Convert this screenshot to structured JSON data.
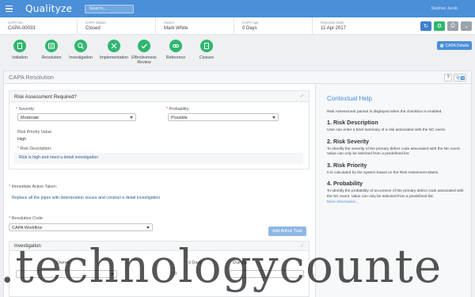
{
  "app": {
    "logo": "Qualityze",
    "search_placeholder": "Search...",
    "user_label": "Stephen Jacob"
  },
  "info": {
    "fields": [
      {
        "label": "CAPA No.",
        "value": "CAPA-00033"
      },
      {
        "label": "CAPA Status",
        "value": "Closed"
      },
      {
        "label": "Owner",
        "value": "Mark White"
      },
      {
        "label": "CAPA Age",
        "value": "0 Days"
      },
      {
        "label": "Reported Date",
        "value": "11 Apr 2017"
      }
    ]
  },
  "steps": [
    "Initiation",
    "Resolution",
    "Investigation",
    "Implementation",
    "Effectiveness Review",
    "Reference",
    "Closure"
  ],
  "capa_details_label": "CAPA Details",
  "panel": {
    "title": "CAPA Resolution",
    "help_btn": "?",
    "attach_count": "0"
  },
  "risk": {
    "title": "Risk Assessment Required?",
    "severity_label": "Severity:",
    "severity_value": "Moderate",
    "probability_label": "Probability:",
    "probability_value": "Possible",
    "priority_label": "Risk Priority Value:",
    "priority_value": "High",
    "description_label": "Risk Description:",
    "description_value": "Risk is high and need a detail investigation"
  },
  "immediate": {
    "label": "Immediate Action Taken:",
    "value": "Replace all the pipes with deterioration issues and conduct a detail investigation"
  },
  "resolution": {
    "label": "Resolution Code:",
    "value": "CAPA Workflow",
    "add_task": "Add Adhoc Task"
  },
  "investigation": {
    "title": "Investigation",
    "col_owner": "Owner",
    "col_days": "d Days",
    "col_due": "Due Da",
    "days_value": "0"
  },
  "help": {
    "title": "Contextual Help",
    "intro": "Risk Assessment pannel is displayed when the checkbox is enabled.",
    "sections": [
      {
        "h": "1. Risk Description",
        "p": "User can enter a brief summary of a risk associated with the NC event."
      },
      {
        "h": "2. Risk Severity",
        "p": "To identify the severity of the primary defect code associated with the NC event. Value can only be selected from a predefined list."
      },
      {
        "h": "3. Risk Priority",
        "p": "It is calculated by the system based on the Risk Assesment Matrix."
      },
      {
        "h": "4. Probability",
        "p": "To identify the probability of occurence of the primary defect code associated with the NC event. Value can only be selected from a predefined list."
      }
    ],
    "more": "More Information..."
  },
  "watermark": ".technologycounte",
  "colors": {
    "primary": "#4a8fd8",
    "step_green": "#2fb76e",
    "topbar": "#4a8fd8"
  }
}
